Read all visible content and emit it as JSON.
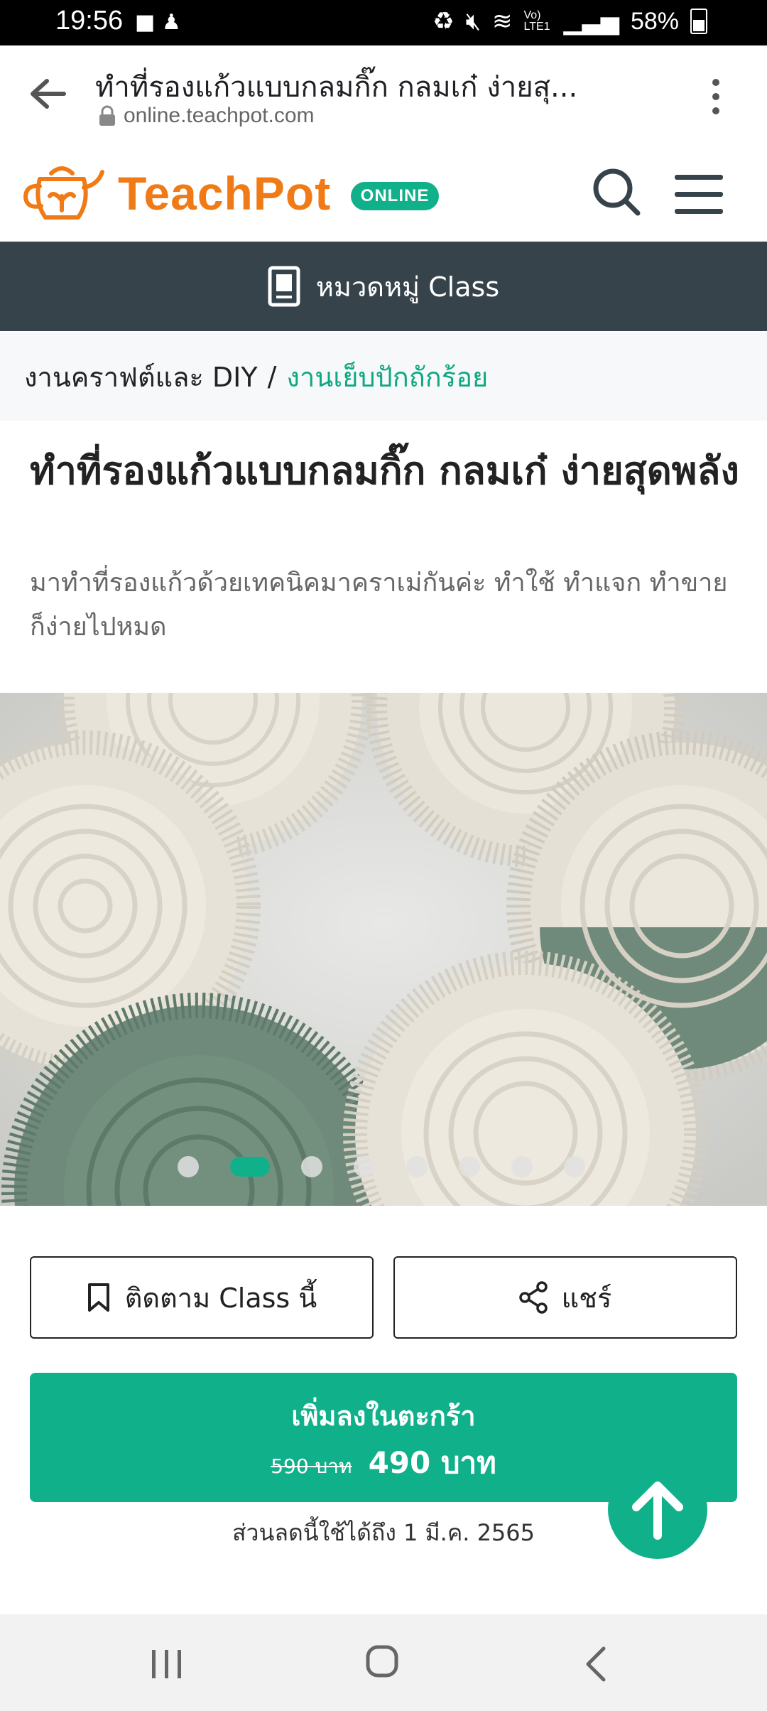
{
  "status_bar": {
    "time": "19:56",
    "battery": "58%",
    "network_label": "Vo) LTE1"
  },
  "browser": {
    "page_title": "ทำที่รองแก้วแบบกลมกิ๊ก กลมเก๋ ง่ายสุ...",
    "url": "online.teachpot.com"
  },
  "site": {
    "logo_text": "TeachPot",
    "logo_badge": "ONLINE",
    "brand_color": "#f07b16",
    "accent_color": "#10b08a"
  },
  "category_bar": {
    "label": "หมวดหมู่ Class"
  },
  "breadcrumb": {
    "items": [
      "งานคราฟต์และ DIY",
      "งานเย็บปักถักร้อย"
    ],
    "separator": "/"
  },
  "course": {
    "title": "ทำที่รองแก้วแบบกลมกิ๊ก กลมเก๋ ง่ายสุดพลัง",
    "subtitle": "มาทำที่รองแก้วด้วยเทคนิคมาคราเม่กันค่ะ ทำใช้ ทำแจก ทำขาย ก็ง่ายไปหมด"
  },
  "gallery": {
    "total_slides": 8,
    "active_index": 1
  },
  "actions": {
    "follow_label": "ติดตาม Class นี้",
    "share_label": "แชร์",
    "cart_label": "เพิ่มลงในตะกร้า",
    "old_price": "590 บาท",
    "new_price": "490 บาท",
    "discount_note": "ส่วนลดนี้ใช้ได้ถึง 1 มี.ค. 2565"
  },
  "icons": {
    "back": "arrow-left-icon",
    "lock": "lock-icon",
    "more": "kebab-icon",
    "search": "search-icon",
    "menu": "hamburger-icon",
    "category": "book-icon",
    "bookmark": "bookmark-icon",
    "share": "share-icon",
    "scroll_top": "arrow-up-icon"
  }
}
